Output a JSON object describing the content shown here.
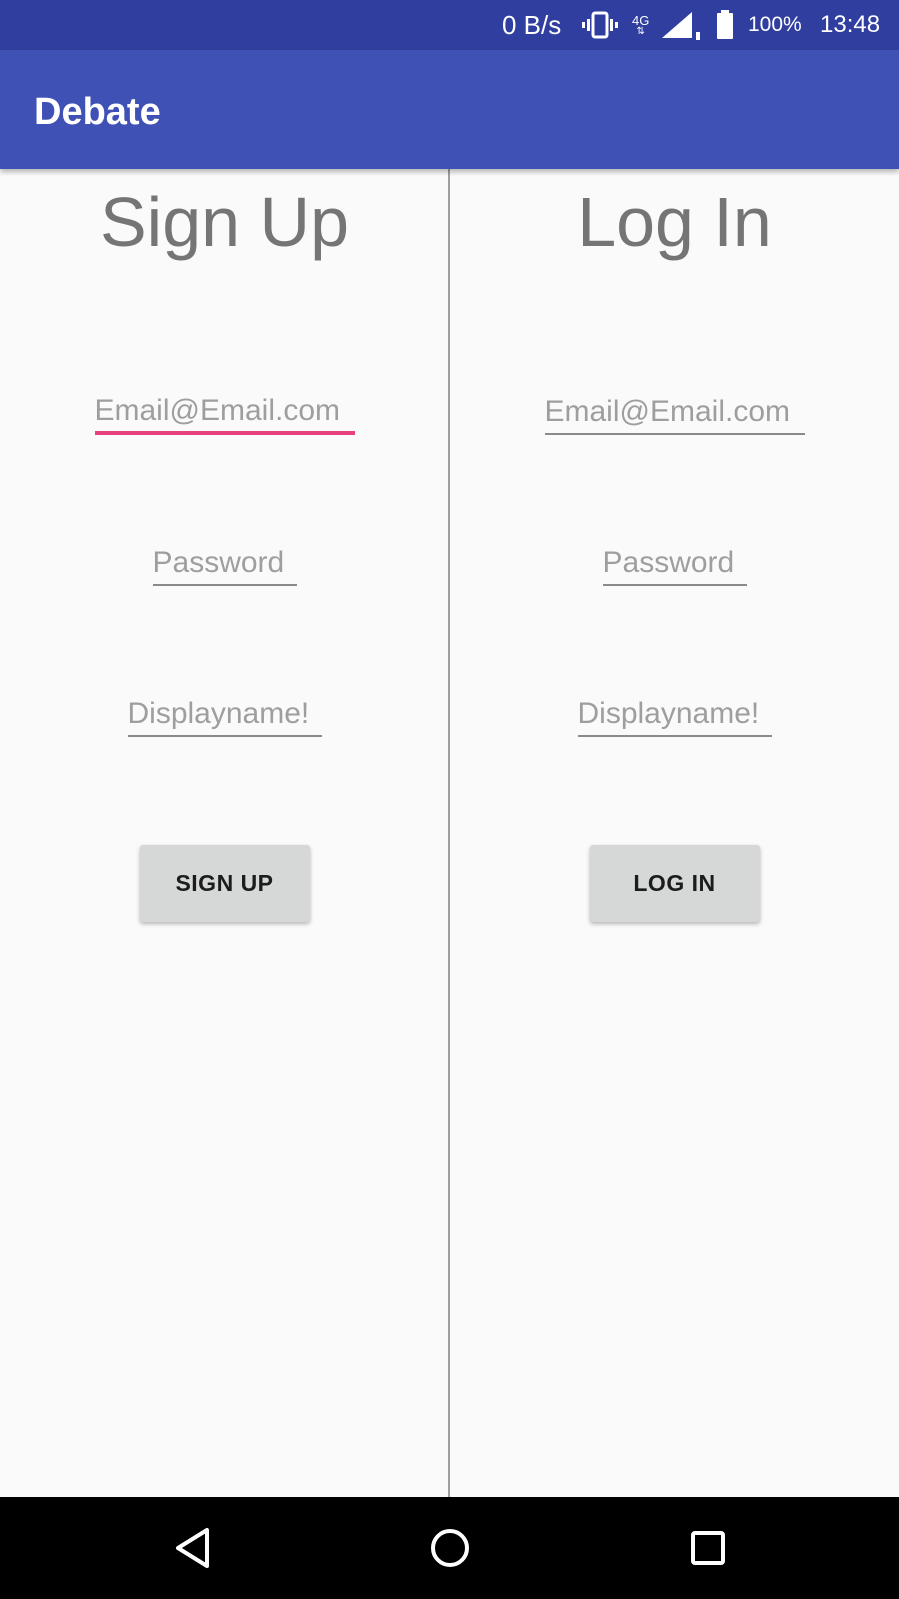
{
  "status_bar": {
    "net_speed": "0 B/s",
    "network_type": "4G",
    "battery_percent": "100%",
    "time": "13:48",
    "icons": [
      "vibrate-icon",
      "network-4g-icon",
      "signal-icon",
      "battery-icon"
    ]
  },
  "app_bar": {
    "title": "Debate"
  },
  "signup": {
    "title": "Sign Up",
    "email_placeholder": "Email@Email.com",
    "password_placeholder": "Password",
    "displayname_placeholder": "Displayname!",
    "button_label": "SIGN UP"
  },
  "login": {
    "title": "Log In",
    "email_placeholder": "Email@Email.com",
    "password_placeholder": "Password",
    "displayname_placeholder": "Displayname!",
    "button_label": "LOG IN"
  },
  "nav_bar": {
    "icons": [
      "back-icon",
      "home-icon",
      "recents-icon"
    ]
  },
  "colors": {
    "status_bar": "#303f9f",
    "app_bar": "#3f51b5",
    "focus_accent": "#e6407f",
    "button": "#d6d7d7",
    "background": "#fafafa"
  }
}
